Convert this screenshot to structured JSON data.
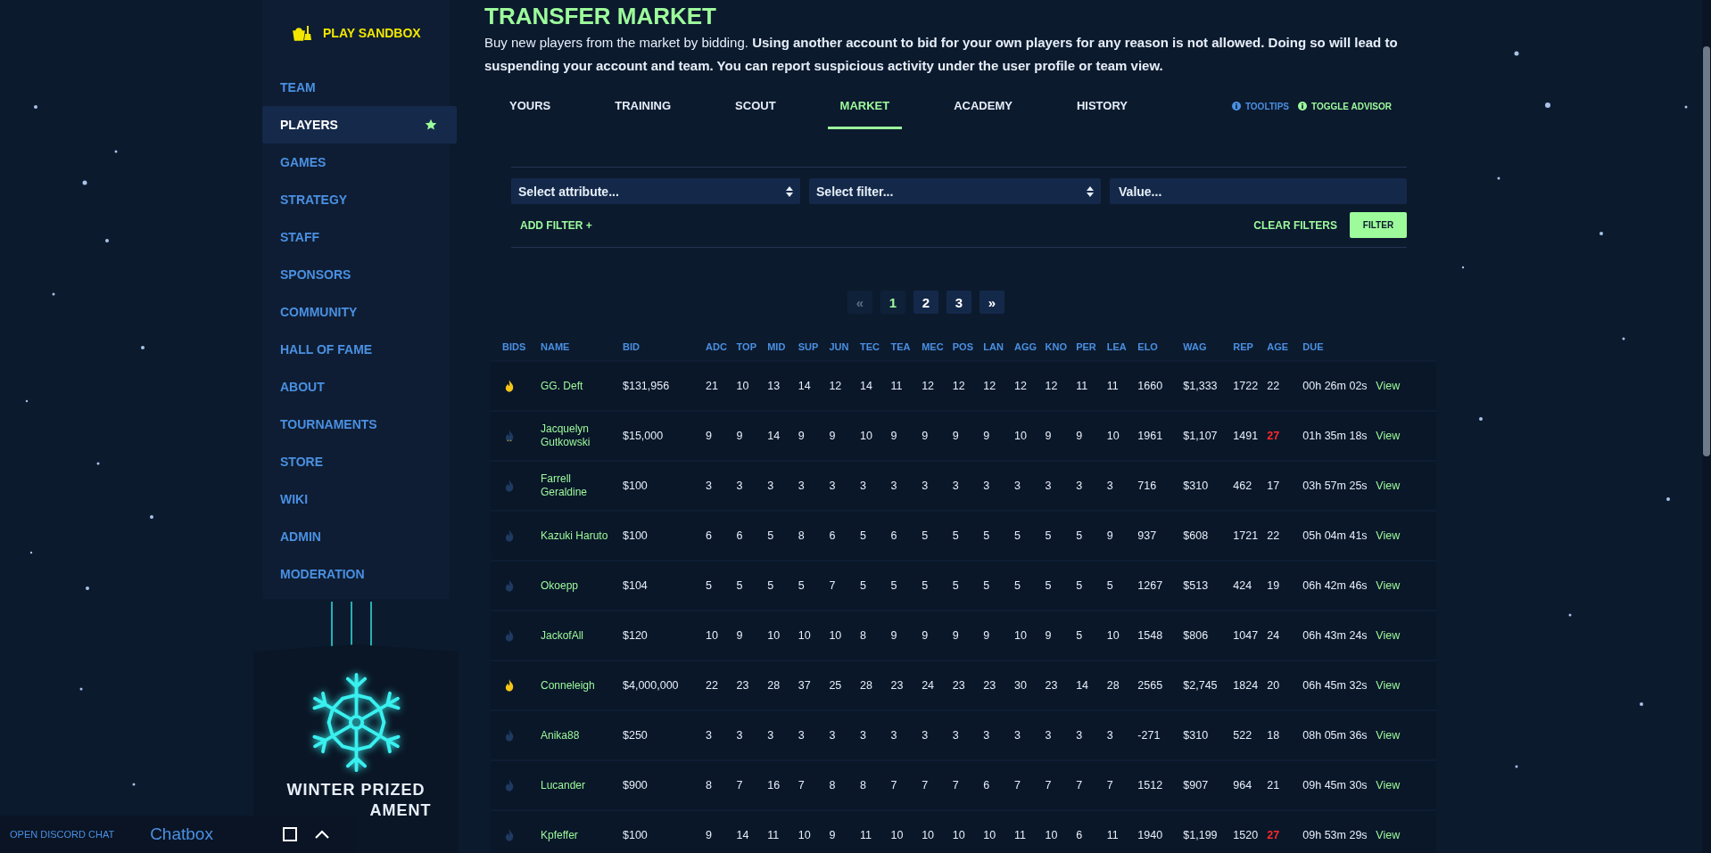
{
  "sidebar": {
    "sandbox": "PLAY SANDBOX",
    "items": [
      {
        "label": "TEAM",
        "selected": false,
        "favorite": false
      },
      {
        "label": "PLAYERS",
        "selected": true,
        "favorite": true
      },
      {
        "label": "GAMES",
        "selected": false,
        "favorite": false
      },
      {
        "label": "STRATEGY",
        "selected": false,
        "favorite": false
      },
      {
        "label": "STAFF",
        "selected": false,
        "favorite": false
      },
      {
        "label": "SPONSORS",
        "selected": false,
        "favorite": false
      },
      {
        "label": "COMMUNITY",
        "selected": false,
        "favorite": false
      },
      {
        "label": "HALL OF FAME",
        "selected": false,
        "favorite": false
      },
      {
        "label": "ABOUT",
        "selected": false,
        "favorite": false
      },
      {
        "label": "TOURNAMENTS",
        "selected": false,
        "favorite": false
      },
      {
        "label": "STORE",
        "selected": false,
        "favorite": false
      },
      {
        "label": "WIKI",
        "selected": false,
        "favorite": false
      },
      {
        "label": "ADMIN",
        "selected": false,
        "favorite": false
      },
      {
        "label": "MODERATION",
        "selected": false,
        "favorite": false
      }
    ],
    "banner": {
      "lines": [
        "WINTER PRIZED",
        "AMENT"
      ]
    }
  },
  "page": {
    "title": "TRANSFER MARKET",
    "description": "Buy new players from the market by bidding. **Using another account to bid for your own players for any reason is not allowed. Doing so will lead to suspending your account and team. You can report suspicious activity under the user profile or team view.**"
  },
  "tabs": [
    {
      "label": "YOURS",
      "selected": false
    },
    {
      "label": "TRAINING",
      "selected": false
    },
    {
      "label": "SCOUT",
      "selected": false
    },
    {
      "label": "MARKET",
      "selected": true
    },
    {
      "label": "ACADEMY",
      "selected": false
    },
    {
      "label": "HISTORY",
      "selected": false
    }
  ],
  "toggles": [
    {
      "label": "TOOLTIPS",
      "color": "#4a90e2"
    },
    {
      "label": "TOGGLE ADVISOR",
      "color": "#9dfb9b"
    }
  ],
  "filters": {
    "attribute": {
      "value": "Select attribute..."
    },
    "filter": {
      "value": "Select filter..."
    },
    "value_field": {
      "placeholder": "Value..."
    },
    "add": "ADD FILTER +",
    "clear": "CLEAR FILTERS",
    "apply": "FILTER"
  },
  "pagination": [
    {
      "label": "«",
      "selected": false,
      "disabled": true
    },
    {
      "label": "1",
      "selected": true,
      "disabled": false
    },
    {
      "label": "2",
      "selected": false,
      "disabled": false
    },
    {
      "label": "3",
      "selected": false,
      "disabled": false
    },
    {
      "label": "»",
      "selected": false,
      "disabled": false
    }
  ],
  "table": {
    "columns": [
      "BIDS",
      "NAME",
      "BID",
      "ADC",
      "TOP",
      "MID",
      "SUP",
      "JUN",
      "TEC",
      "TEA",
      "MEC",
      "POS",
      "LAN",
      "AGG",
      "KNO",
      "PER",
      "LEA",
      "ELO",
      "WAG",
      "REP",
      "AGE",
      "DUE"
    ],
    "rows": [
      {
        "kind": "hot",
        "name": "GG. Deft",
        "bid": "$131,956",
        "stats": [
          "21",
          "10",
          "13",
          "14",
          "12",
          "14",
          "11",
          "12",
          "12",
          "12",
          "12",
          "12",
          "11",
          "11"
        ],
        "elo": "1660",
        "wag": "$1,333",
        "rep": "1722",
        "age": "22",
        "age_warning": false,
        "due": "00h 26m 02s",
        "action": "View"
      },
      {
        "kind": "warm",
        "name": "Jacquelyn Gutkowski",
        "bid": "$15,000",
        "stats": [
          "9",
          "9",
          "14",
          "9",
          "9",
          "10",
          "9",
          "9",
          "9",
          "9",
          "10",
          "9",
          "9",
          "10"
        ],
        "elo": "1961",
        "wag": "$1,107",
        "rep": "1491",
        "age": "27",
        "age_warning": true,
        "due": "01h 35m 18s",
        "action": "View"
      },
      {
        "kind": "cold",
        "name": "Farrell Geraldine",
        "bid": "$100",
        "stats": [
          "3",
          "3",
          "3",
          "3",
          "3",
          "3",
          "3",
          "3",
          "3",
          "3",
          "3",
          "3",
          "3",
          "3"
        ],
        "elo": "716",
        "wag": "$310",
        "rep": "462",
        "age": "17",
        "age_warning": false,
        "due": "03h 57m 25s",
        "action": "View"
      },
      {
        "kind": "cold",
        "name": "Kazuki Haruto",
        "bid": "$100",
        "stats": [
          "6",
          "6",
          "5",
          "8",
          "6",
          "5",
          "6",
          "5",
          "5",
          "5",
          "5",
          "5",
          "5",
          "9"
        ],
        "elo": "937",
        "wag": "$608",
        "rep": "1721",
        "age": "22",
        "age_warning": false,
        "due": "05h 04m 41s",
        "action": "View"
      },
      {
        "kind": "cold",
        "name": "Okoepp",
        "bid": "$104",
        "stats": [
          "5",
          "5",
          "5",
          "5",
          "7",
          "5",
          "5",
          "5",
          "5",
          "5",
          "5",
          "5",
          "5",
          "5"
        ],
        "elo": "1267",
        "wag": "$513",
        "rep": "424",
        "age": "19",
        "age_warning": false,
        "due": "06h 42m 46s",
        "action": "View"
      },
      {
        "kind": "cold",
        "name": "JackofAll",
        "bid": "$120",
        "stats": [
          "10",
          "9",
          "10",
          "10",
          "10",
          "8",
          "9",
          "9",
          "9",
          "9",
          "10",
          "9",
          "5",
          "10"
        ],
        "elo": "1548",
        "wag": "$806",
        "rep": "1047",
        "age": "24",
        "age_warning": false,
        "due": "06h 43m 24s",
        "action": "View"
      },
      {
        "kind": "hot",
        "name": "Conneleigh",
        "bid": "$4,000,000",
        "stats": [
          "22",
          "23",
          "28",
          "37",
          "25",
          "28",
          "23",
          "24",
          "23",
          "23",
          "30",
          "23",
          "14",
          "28"
        ],
        "elo": "2565",
        "wag": "$2,745",
        "rep": "1824",
        "age": "20",
        "age_warning": false,
        "due": "06h 45m 32s",
        "action": "View"
      },
      {
        "kind": "cold",
        "name": "Anika88",
        "bid": "$250",
        "stats": [
          "3",
          "3",
          "3",
          "3",
          "3",
          "3",
          "3",
          "3",
          "3",
          "3",
          "3",
          "3",
          "3",
          "3"
        ],
        "elo": "-271",
        "wag": "$310",
        "rep": "522",
        "age": "18",
        "age_warning": false,
        "due": "08h 05m 36s",
        "action": "View"
      },
      {
        "kind": "cold",
        "name": "Lucander",
        "bid": "$900",
        "stats": [
          "8",
          "7",
          "16",
          "7",
          "8",
          "8",
          "7",
          "7",
          "7",
          "6",
          "7",
          "7",
          "7",
          "7"
        ],
        "elo": "1512",
        "wag": "$907",
        "rep": "964",
        "age": "21",
        "age_warning": false,
        "due": "09h 45m 30s",
        "action": "View"
      },
      {
        "kind": "cold",
        "name": "Kpfeffer",
        "bid": "$100",
        "stats": [
          "9",
          "14",
          "11",
          "10",
          "9",
          "11",
          "10",
          "10",
          "10",
          "10",
          "11",
          "10",
          "6",
          "11"
        ],
        "elo": "1940",
        "wag": "$1,199",
        "rep": "1520",
        "age": "27",
        "age_warning": true,
        "due": "09h 53m 29s",
        "action": "View"
      }
    ]
  },
  "chat": {
    "discord": "OPEN DISCORD CHAT",
    "title": "Chatbox"
  }
}
